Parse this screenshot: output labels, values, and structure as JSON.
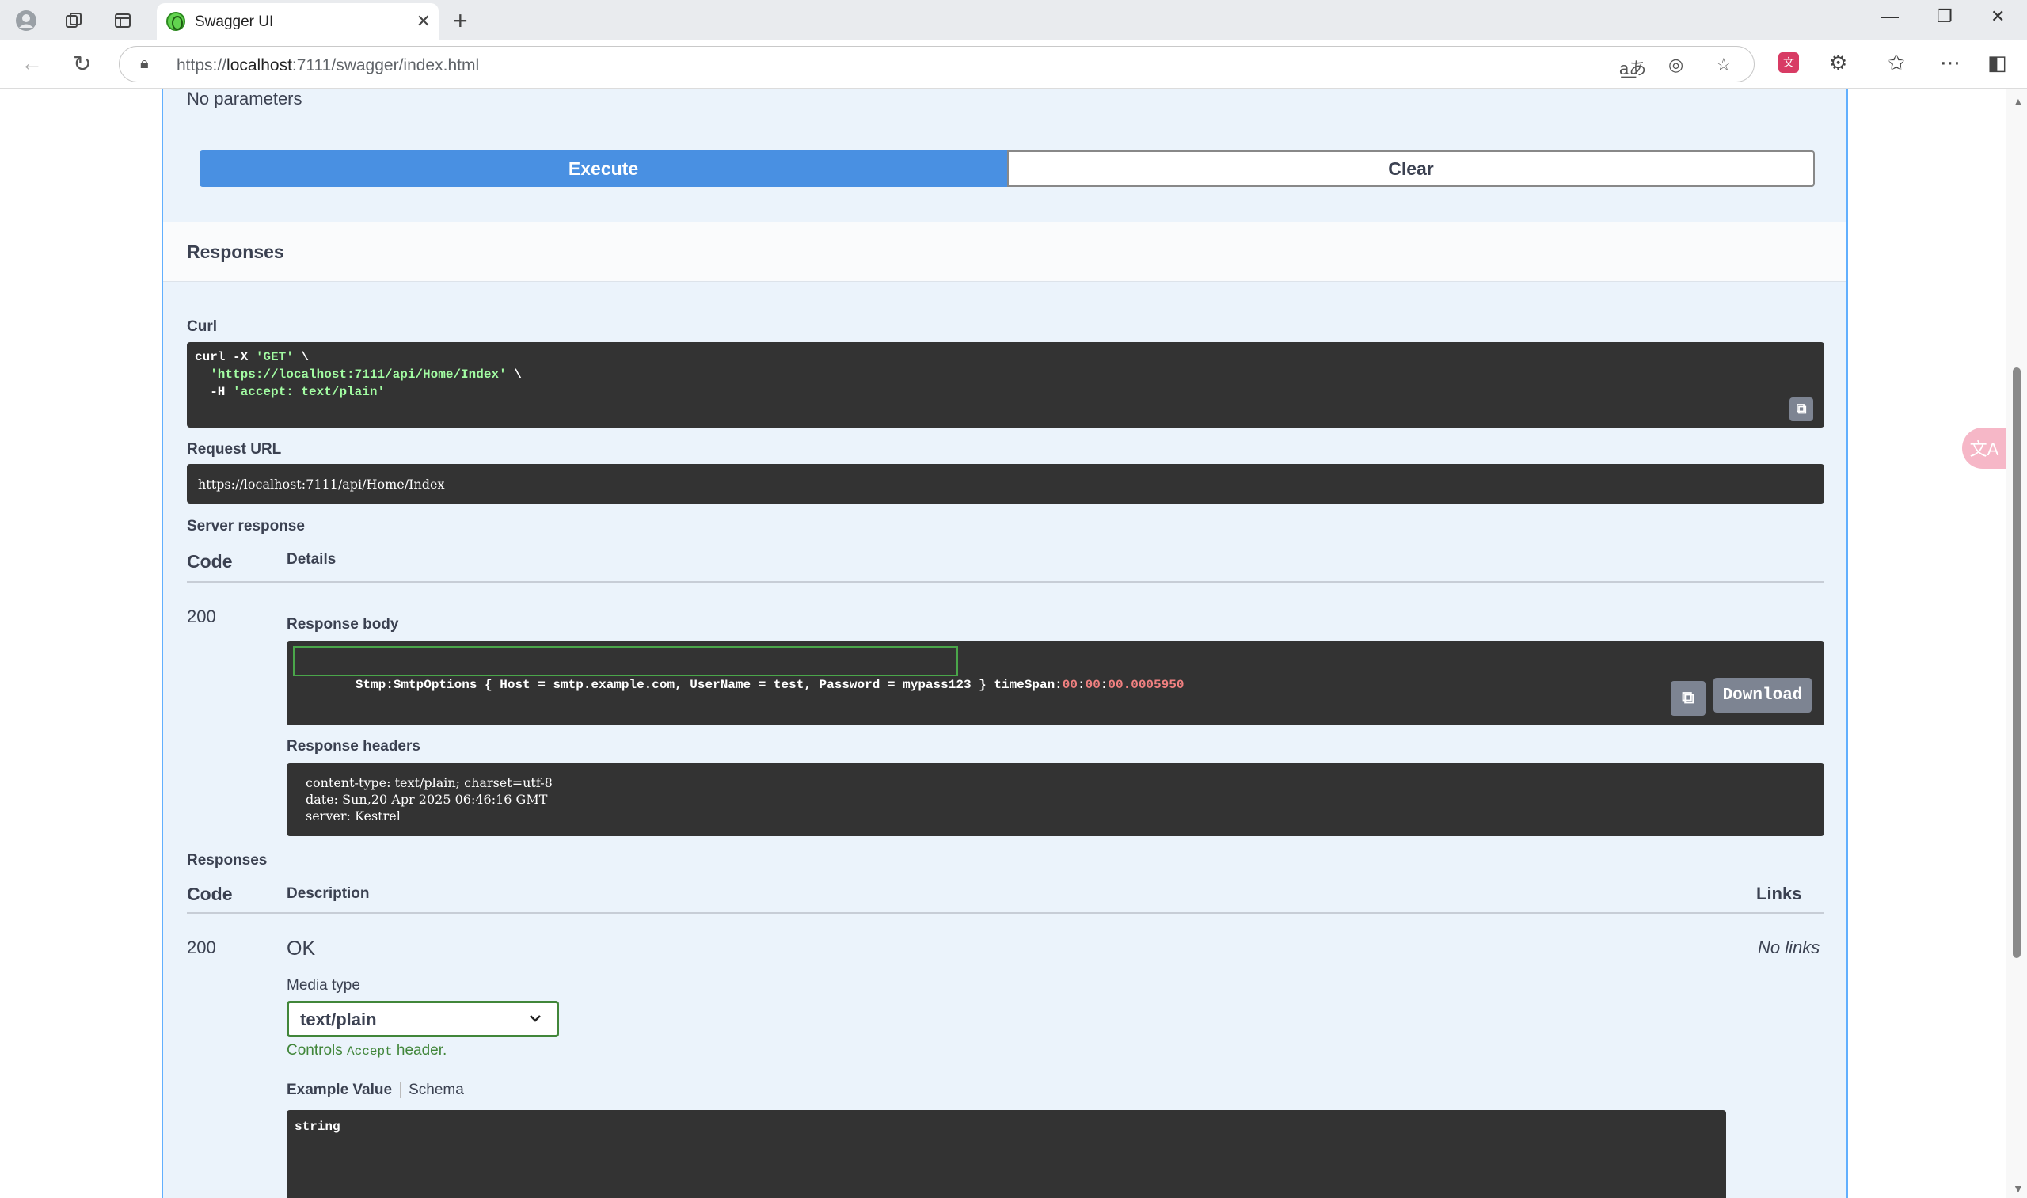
{
  "browser": {
    "tab_title": "Swagger UI",
    "url_prefix": "https://",
    "url_host": "localhost",
    "url_rest": ":7111/swagger/index.html",
    "icons": [
      "profile-icon",
      "collections-icon",
      "tab-actions-icon",
      "close-icon",
      "new-tab-icon",
      "back-icon",
      "refresh-icon",
      "lock-icon",
      "read-aloud-icon",
      "edge-icon",
      "favorite-icon",
      "translate-ext-icon",
      "extensions-icon",
      "favorites-icon",
      "more-icon",
      "sidebar-icon"
    ]
  },
  "operation": {
    "no_parameters": "No parameters",
    "execute_label": "Execute",
    "clear_label": "Clear",
    "responses_heading": "Responses",
    "curl_label": "Curl",
    "curl_lines": [
      {
        "cmd": "curl -X ",
        "str": "'GET'",
        "tail": " \\"
      },
      {
        "cmd": "  ",
        "str": "'https://localhost:7111/api/Home/Index'",
        "tail": " \\"
      },
      {
        "cmd": "  -H ",
        "str": "'accept: text/plain'",
        "tail": ""
      }
    ],
    "request_url_label": "Request URL",
    "request_url": "https://localhost:7111/api/Home/Index",
    "server_response_label": "Server response",
    "code_header": "Code",
    "details_header": "Details",
    "server_code": "200",
    "response_body_label": "Response body",
    "response_body_main": "Stmp:SmtpOptions { Host = smtp.example.com, UserName = test, Password = mypass123 }",
    "response_body_timespan_label": "timeSpan:",
    "response_body_timespan_parts": [
      "00",
      ":",
      "00",
      ":",
      "00.0005950"
    ],
    "download_label": "Download",
    "response_headers_label": "Response headers",
    "response_headers": [
      "content-type: text/plain; charset=utf-8",
      "date: Sun,20 Apr 2025 06:46:16 GMT",
      "server: Kestrel"
    ],
    "responses_label": "Responses",
    "description_header": "Description",
    "links_header": "Links",
    "resp_code": "200",
    "resp_description": "OK",
    "resp_links": "No links",
    "media_type_label": "Media type",
    "media_type_value": "text/plain",
    "controls_prefix": "Controls ",
    "controls_code": "Accept",
    "controls_suffix": " header.",
    "example_value_tab": "Example Value",
    "schema_tab": "Schema",
    "example_value": "string"
  },
  "colors": {
    "execute": "#4990e2",
    "get_border": "#61affe",
    "select_border": "#41863a",
    "code_bg": "#333333",
    "string_green": "#a2fca2",
    "timespan_red": "#f08080"
  }
}
